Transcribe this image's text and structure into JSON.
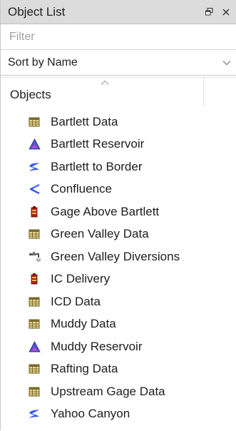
{
  "panel": {
    "title": "Object List",
    "float_icon": "float-window-icon",
    "close_icon": "close-icon"
  },
  "filter": {
    "placeholder": "Filter",
    "value": ""
  },
  "sort": {
    "selected": "Sort by Name"
  },
  "column": {
    "header": "Objects"
  },
  "items": [
    {
      "label": "Bartlett Data",
      "icon": "data-table-icon"
    },
    {
      "label": "Bartlett Reservoir",
      "icon": "reservoir-icon"
    },
    {
      "label": "Bartlett to Border",
      "icon": "reach-icon"
    },
    {
      "label": "Confluence",
      "icon": "confluence-icon"
    },
    {
      "label": "Gage Above Bartlett",
      "icon": "gage-icon"
    },
    {
      "label": "Green Valley Data",
      "icon": "data-table-icon"
    },
    {
      "label": "Green Valley Diversions",
      "icon": "diversion-icon"
    },
    {
      "label": "IC Delivery",
      "icon": "gage-icon"
    },
    {
      "label": "ICD Data",
      "icon": "data-table-icon"
    },
    {
      "label": "Muddy Data",
      "icon": "data-table-icon"
    },
    {
      "label": "Muddy Reservoir",
      "icon": "reservoir-icon"
    },
    {
      "label": "Rafting Data",
      "icon": "data-table-icon"
    },
    {
      "label": "Upstream Gage Data",
      "icon": "data-table-icon"
    },
    {
      "label": "Yahoo Canyon",
      "icon": "reach-icon"
    }
  ]
}
